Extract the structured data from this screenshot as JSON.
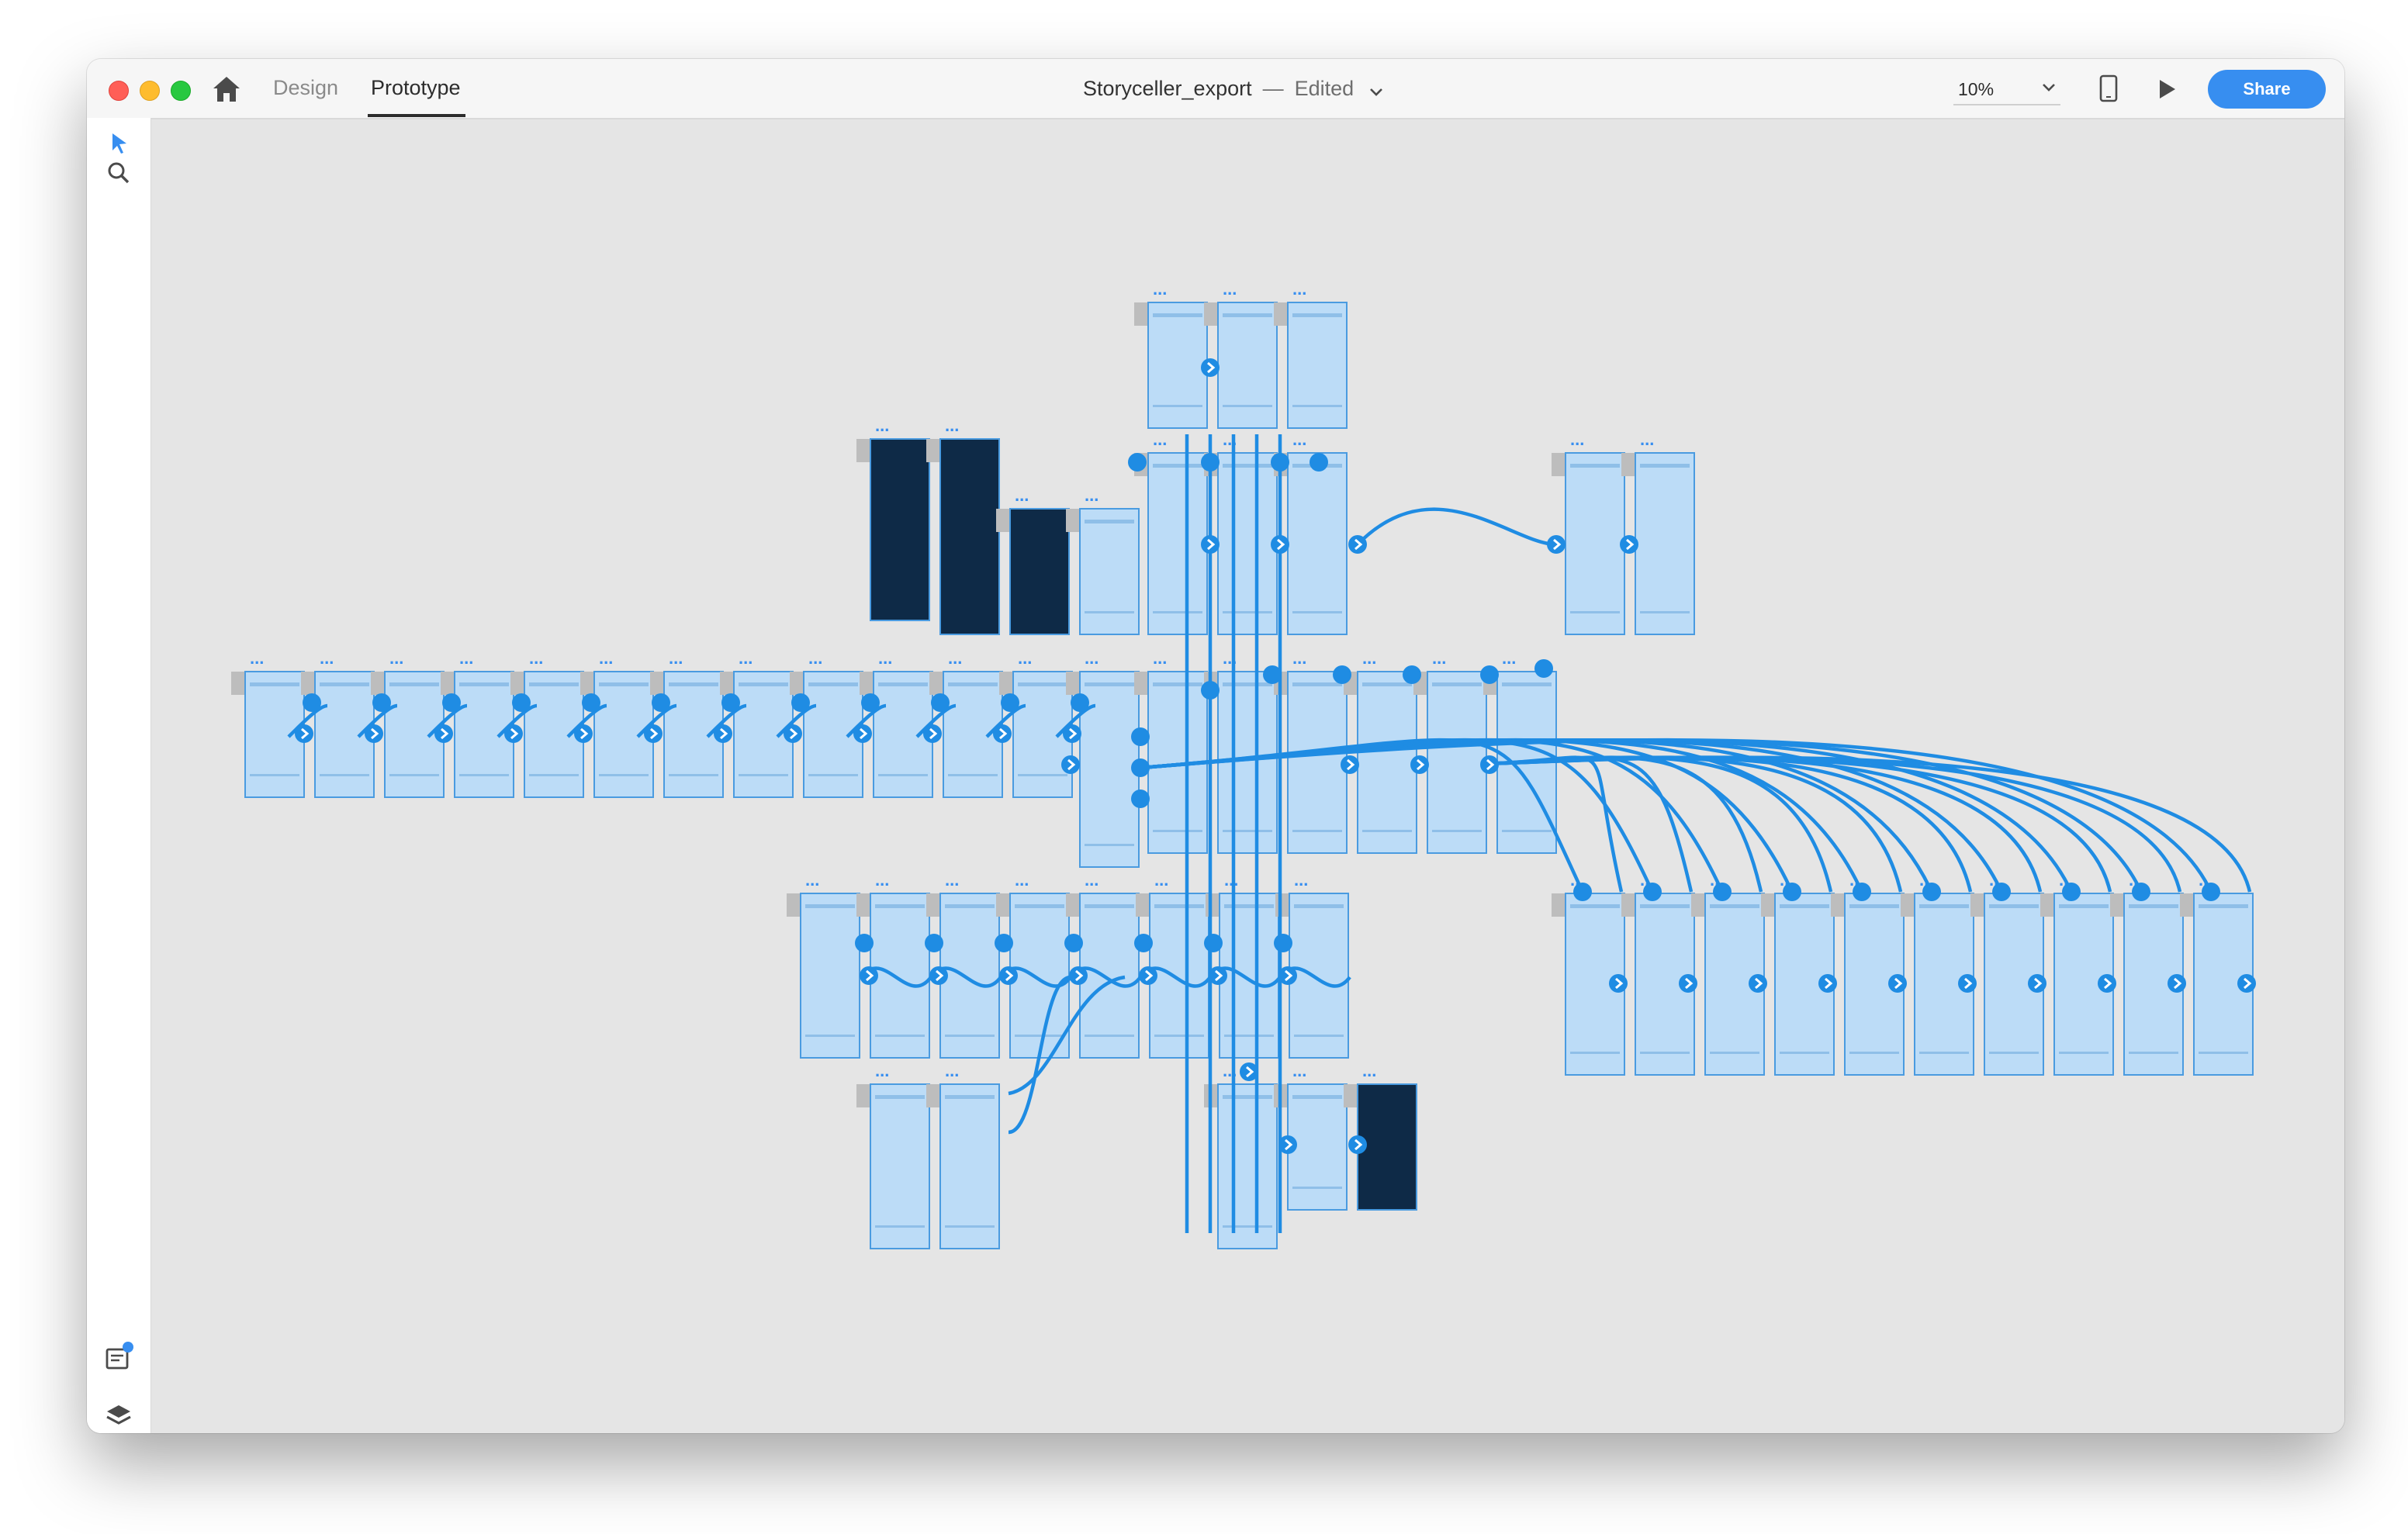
{
  "window": {
    "tabs": [
      {
        "label": "Design",
        "active": false
      },
      {
        "label": "Prototype",
        "active": true
      }
    ],
    "document_title": "Storyceller_export",
    "separator": "—",
    "edit_status": "Edited",
    "zoom": "10%",
    "share_label": "Share"
  },
  "toolbar": {
    "tools": [
      "select-tool-icon",
      "zoom-tool-icon"
    ],
    "bottom": [
      "assets-panel-icon",
      "layers-panel-icon"
    ]
  },
  "colors": {
    "accent": "#378ef0",
    "wire": "#1f8ce3",
    "artboard_fill": "#bcdcf7",
    "artboard_border": "#4a9be0",
    "dark_artboard": "#0e2a47",
    "canvas_bg": "#e5e5e5"
  },
  "canvas": {
    "artboard_name_glyph": "...",
    "prototype_wires": "connections between artboards"
  }
}
